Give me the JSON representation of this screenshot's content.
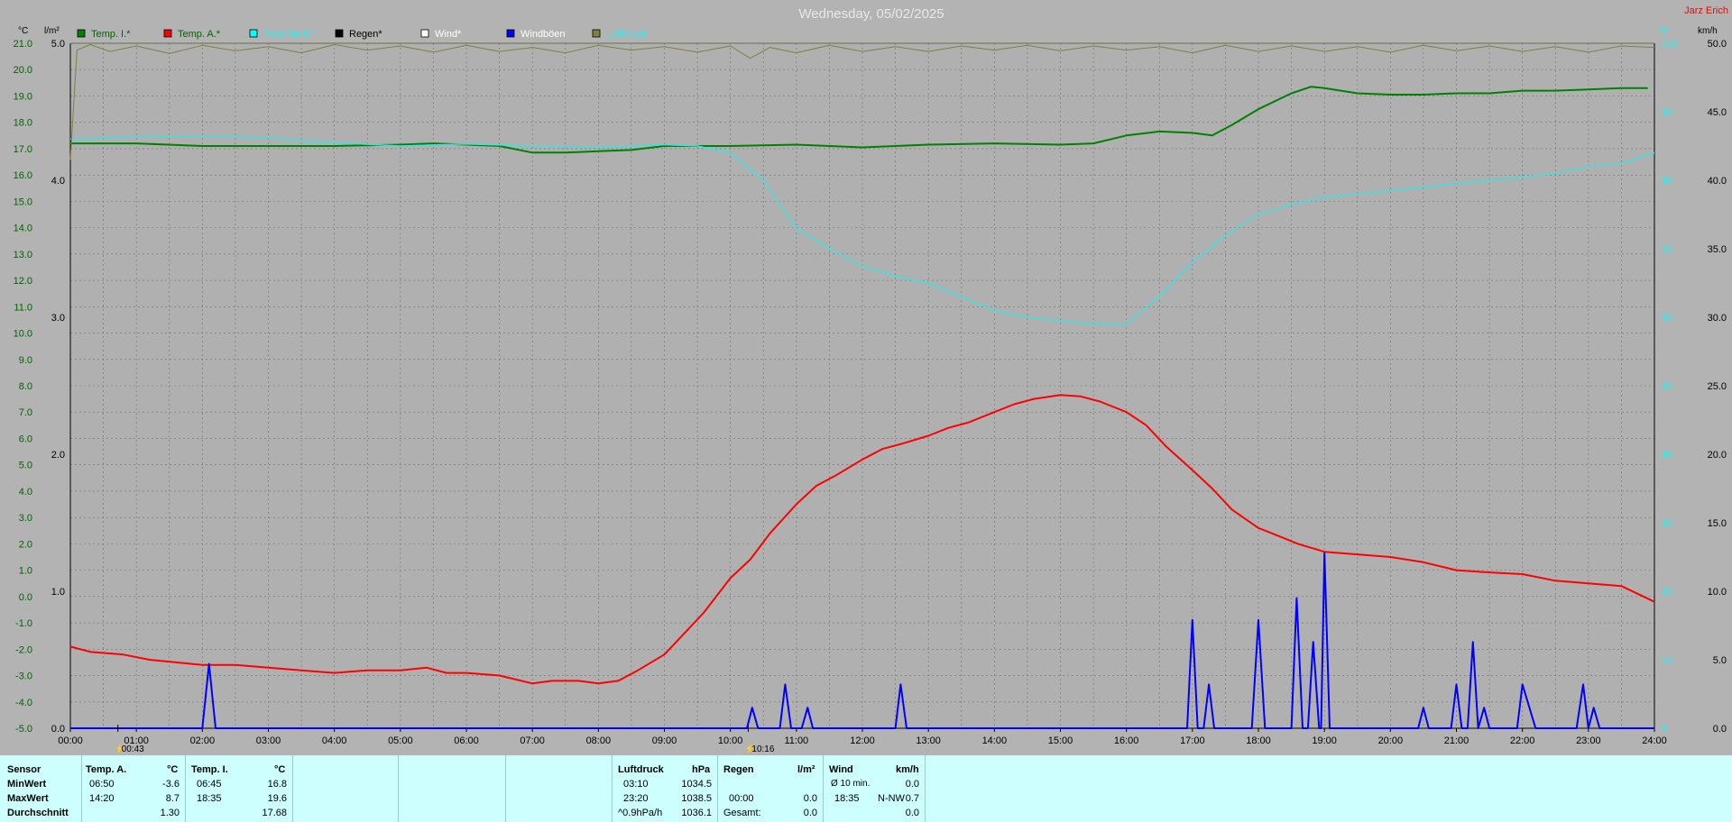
{
  "title": "Wednesday, 05/02/2025",
  "station": "Jarz Erich",
  "units": {
    "left1": "°C",
    "left2": "l/m²",
    "right1": "%",
    "right2": "km/h"
  },
  "legend": [
    {
      "label": "Temp. I.*",
      "color": "#008000",
      "text_color": "#006400"
    },
    {
      "label": "Temp. A.*",
      "color": "#ff0000",
      "text_color": "#006400"
    },
    {
      "label": "Feuchte A.*",
      "color": "#00ffff",
      "text_color": "#00ffff"
    },
    {
      "label": "Regen*",
      "color": "#000000",
      "text_color": "#000000"
    },
    {
      "label": "Wind*",
      "color": "#ffffff",
      "text_color": "#ffffff"
    },
    {
      "label": "Windböen",
      "color": "#0000ff",
      "text_color": "#ffffff"
    },
    {
      "label": "Luftdruck",
      "color": "#808040",
      "text_color": "#00ffff"
    }
  ],
  "markers": [
    {
      "label": "00:43"
    },
    {
      "label": "10:16"
    }
  ],
  "chart_data": {
    "type": "line",
    "x_unit": "hours",
    "x_ticks": [
      "00:00",
      "01:00",
      "02:00",
      "03:00",
      "04:00",
      "05:00",
      "06:00",
      "07:00",
      "08:00",
      "09:00",
      "10:00",
      "11:00",
      "12:00",
      "13:00",
      "14:00",
      "15:00",
      "16:00",
      "17:00",
      "18:00",
      "19:00",
      "20:00",
      "21:00",
      "22:00",
      "23:00",
      "24:00"
    ],
    "y_axes": {
      "temp": {
        "ticks": [
          "21.0",
          "20.0",
          "19.0",
          "18.0",
          "17.0",
          "16.0",
          "15.0",
          "14.0",
          "13.0",
          "12.0",
          "11.0",
          "10.0",
          "9.0",
          "8.0",
          "7.0",
          "6.0",
          "5.0",
          "4.0",
          "3.0",
          "2.0",
          "1.0",
          "0.0",
          "-1.0",
          "-2.0",
          "-3.0",
          "-4.0",
          "-5.0"
        ],
        "range": [
          -5,
          21
        ]
      },
      "rain": {
        "ticks": [
          "5.0",
          "4.0",
          "3.0",
          "2.0",
          "1.0",
          "0.0"
        ],
        "range": [
          0,
          5
        ]
      },
      "humidity": {
        "ticks": [
          "100",
          "90",
          "80",
          "70",
          "60",
          "50",
          "40",
          "30",
          "20",
          "10",
          "0"
        ],
        "range": [
          0,
          100
        ]
      },
      "wind": {
        "ticks": [
          "50.0",
          "45.0",
          "40.0",
          "35.0",
          "30.0",
          "25.0",
          "20.0",
          "15.0",
          "10.0",
          "5.0",
          "0.0"
        ],
        "range": [
          0,
          50
        ]
      }
    },
    "series": [
      {
        "name": "Temp. I.*",
        "axis": "temp",
        "color": "#008000",
        "width": 2,
        "points": [
          [
            0,
            17.2
          ],
          [
            1,
            17.2
          ],
          [
            2,
            17.1
          ],
          [
            3,
            17.1
          ],
          [
            4,
            17.1
          ],
          [
            5,
            17.15
          ],
          [
            5.5,
            17.2
          ],
          [
            6,
            17.15
          ],
          [
            6.5,
            17.1
          ],
          [
            7,
            16.85
          ],
          [
            7.5,
            16.85
          ],
          [
            8,
            16.9
          ],
          [
            8.5,
            16.95
          ],
          [
            9,
            17.1
          ],
          [
            10,
            17.1
          ],
          [
            11,
            17.15
          ],
          [
            12,
            17.05
          ],
          [
            13,
            17.15
          ],
          [
            14,
            17.2
          ],
          [
            15,
            17.15
          ],
          [
            15.5,
            17.2
          ],
          [
            16,
            17.5
          ],
          [
            16.5,
            17.65
          ],
          [
            17,
            17.6
          ],
          [
            17.3,
            17.5
          ],
          [
            17.6,
            17.9
          ],
          [
            18,
            18.5
          ],
          [
            18.5,
            19.1
          ],
          [
            18.8,
            19.35
          ],
          [
            19,
            19.3
          ],
          [
            19.5,
            19.1
          ],
          [
            20,
            19.05
          ],
          [
            20.5,
            19.05
          ],
          [
            21,
            19.1
          ],
          [
            21.5,
            19.1
          ],
          [
            22,
            19.2
          ],
          [
            22.5,
            19.2
          ],
          [
            23,
            19.25
          ],
          [
            23.5,
            19.3
          ],
          [
            23.9,
            19.3
          ]
        ]
      },
      {
        "name": "Temp. A.*",
        "axis": "temp",
        "color": "#ff0000",
        "width": 2,
        "points": [
          [
            0,
            -1.9
          ],
          [
            0.3,
            -2.1
          ],
          [
            0.8,
            -2.2
          ],
          [
            1.2,
            -2.4
          ],
          [
            1.6,
            -2.5
          ],
          [
            2,
            -2.6
          ],
          [
            2.5,
            -2.6
          ],
          [
            3,
            -2.7
          ],
          [
            3.5,
            -2.8
          ],
          [
            4,
            -2.9
          ],
          [
            4.5,
            -2.8
          ],
          [
            5,
            -2.8
          ],
          [
            5.4,
            -2.7
          ],
          [
            5.7,
            -2.9
          ],
          [
            6,
            -2.9
          ],
          [
            6.5,
            -3.0
          ],
          [
            7,
            -3.3
          ],
          [
            7.3,
            -3.2
          ],
          [
            7.7,
            -3.2
          ],
          [
            8,
            -3.3
          ],
          [
            8.3,
            -3.2
          ],
          [
            8.6,
            -2.8
          ],
          [
            9,
            -2.2
          ],
          [
            9.3,
            -1.4
          ],
          [
            9.6,
            -0.6
          ],
          [
            10,
            0.7
          ],
          [
            10.3,
            1.4
          ],
          [
            10.6,
            2.4
          ],
          [
            11,
            3.5
          ],
          [
            11.3,
            4.2
          ],
          [
            11.6,
            4.6
          ],
          [
            12,
            5.2
          ],
          [
            12.3,
            5.6
          ],
          [
            12.6,
            5.8
          ],
          [
            13,
            6.1
          ],
          [
            13.3,
            6.4
          ],
          [
            13.6,
            6.6
          ],
          [
            14,
            7.0
          ],
          [
            14.3,
            7.3
          ],
          [
            14.6,
            7.5
          ],
          [
            15,
            7.65
          ],
          [
            15.3,
            7.6
          ],
          [
            15.6,
            7.4
          ],
          [
            16,
            7.0
          ],
          [
            16.3,
            6.5
          ],
          [
            16.6,
            5.7
          ],
          [
            17,
            4.8
          ],
          [
            17.3,
            4.1
          ],
          [
            17.6,
            3.3
          ],
          [
            18,
            2.6
          ],
          [
            18.3,
            2.3
          ],
          [
            18.6,
            2.0
          ],
          [
            19,
            1.7
          ],
          [
            19.5,
            1.6
          ],
          [
            20,
            1.5
          ],
          [
            20.5,
            1.3
          ],
          [
            21,
            1.0
          ],
          [
            21.3,
            0.95
          ],
          [
            21.6,
            0.9
          ],
          [
            22,
            0.85
          ],
          [
            22.5,
            0.6
          ],
          [
            23,
            0.5
          ],
          [
            23.5,
            0.4
          ],
          [
            24,
            -0.2
          ]
        ]
      },
      {
        "name": "Feuchte A.*",
        "axis": "humidity",
        "color": "#40e0e0",
        "width": 1.5,
        "points": [
          [
            0,
            86
          ],
          [
            0.5,
            86.2
          ],
          [
            1,
            86.4
          ],
          [
            2,
            86.5
          ],
          [
            3,
            86.2
          ],
          [
            4,
            85.5
          ],
          [
            5,
            85
          ],
          [
            6,
            85.3
          ],
          [
            7,
            85
          ],
          [
            8,
            84.8
          ],
          [
            9,
            85.2
          ],
          [
            9.5,
            85
          ],
          [
            10,
            84
          ],
          [
            10.5,
            80
          ],
          [
            11,
            73
          ],
          [
            11.5,
            70
          ],
          [
            12,
            67.5
          ],
          [
            12.5,
            66
          ],
          [
            13,
            65
          ],
          [
            13.5,
            63
          ],
          [
            14,
            61
          ],
          [
            14.5,
            60
          ],
          [
            15,
            59.5
          ],
          [
            15.5,
            59
          ],
          [
            16,
            59
          ],
          [
            16.5,
            63
          ],
          [
            17,
            68
          ],
          [
            17.5,
            72
          ],
          [
            18,
            75
          ],
          [
            18.5,
            76.5
          ],
          [
            19,
            77.5
          ],
          [
            19.5,
            78
          ],
          [
            20,
            78.5
          ],
          [
            20.5,
            79
          ],
          [
            21,
            79.5
          ],
          [
            21.5,
            80
          ],
          [
            22,
            80.5
          ],
          [
            22.5,
            81
          ],
          [
            23,
            82
          ],
          [
            23.5,
            82.5
          ],
          [
            24,
            84
          ]
        ]
      },
      {
        "name": "Luftdruck",
        "axis": "humidity",
        "color": "#808040",
        "width": 1,
        "points": [
          [
            0,
            83
          ],
          [
            0.1,
            99
          ],
          [
            0.3,
            99.8
          ],
          [
            0.6,
            98.8
          ],
          [
            1,
            99.6
          ],
          [
            1.5,
            98.5
          ],
          [
            2,
            99.7
          ],
          [
            2.5,
            98.9
          ],
          [
            3,
            99.5
          ],
          [
            3.5,
            98.6
          ],
          [
            4,
            99.8
          ],
          [
            4.5,
            99
          ],
          [
            5,
            99.6
          ],
          [
            5.5,
            98.7
          ],
          [
            6,
            99.7
          ],
          [
            6.5,
            98.8
          ],
          [
            7,
            99.4
          ],
          [
            7.5,
            98.6
          ],
          [
            8,
            99.7
          ],
          [
            8.5,
            99
          ],
          [
            9,
            99.5
          ],
          [
            9.5,
            98.7
          ],
          [
            10,
            99.6
          ],
          [
            10.3,
            97.8
          ],
          [
            10.6,
            99.4
          ],
          [
            11,
            98.6
          ],
          [
            11.5,
            99.7
          ],
          [
            12,
            98.8
          ],
          [
            12.5,
            99.5
          ],
          [
            13,
            98.8
          ],
          [
            13.5,
            99.6
          ],
          [
            14,
            99
          ],
          [
            14.5,
            99.7
          ],
          [
            15,
            98.9
          ],
          [
            15.5,
            99.6
          ],
          [
            16,
            99
          ],
          [
            16.5,
            99.5
          ],
          [
            17,
            98.6
          ],
          [
            17.5,
            99.7
          ],
          [
            18,
            98.8
          ],
          [
            18.5,
            99.6
          ],
          [
            19,
            98.8
          ],
          [
            19.5,
            99.5
          ],
          [
            20,
            98.7
          ],
          [
            20.5,
            99.7
          ],
          [
            21,
            98.9
          ],
          [
            21.5,
            99.6
          ],
          [
            22,
            98.8
          ],
          [
            22.5,
            99.5
          ],
          [
            23,
            98.7
          ],
          [
            23.5,
            99.6
          ],
          [
            24,
            99.4
          ]
        ]
      },
      {
        "name": "Windböen",
        "axis": "wind",
        "color": "#0000ff",
        "width": 2,
        "points": [
          [
            0,
            0
          ],
          [
            2,
            0
          ],
          [
            2.1,
            4.7
          ],
          [
            2.2,
            0
          ],
          [
            10.25,
            0
          ],
          [
            10.33,
            1.5
          ],
          [
            10.42,
            0
          ],
          [
            10.75,
            0
          ],
          [
            10.83,
            3.2
          ],
          [
            10.92,
            0
          ],
          [
            11.08,
            0
          ],
          [
            11.17,
            1.5
          ],
          [
            11.25,
            0
          ],
          [
            12.5,
            0
          ],
          [
            12.58,
            3.2
          ],
          [
            12.67,
            0
          ],
          [
            16.92,
            0
          ],
          [
            17,
            7.9
          ],
          [
            17.08,
            0
          ],
          [
            17.17,
            0
          ],
          [
            17.25,
            3.2
          ],
          [
            17.33,
            0
          ],
          [
            17.9,
            0
          ],
          [
            18,
            7.9
          ],
          [
            18.1,
            0
          ],
          [
            18.5,
            0
          ],
          [
            18.58,
            9.5
          ],
          [
            18.67,
            0
          ],
          [
            18.75,
            0
          ],
          [
            18.83,
            6.3
          ],
          [
            18.92,
            0
          ],
          [
            18.95,
            0
          ],
          [
            19,
            12.8
          ],
          [
            19.08,
            0
          ],
          [
            20.42,
            0
          ],
          [
            20.5,
            1.5
          ],
          [
            20.58,
            0
          ],
          [
            20.92,
            0
          ],
          [
            21,
            3.2
          ],
          [
            21.08,
            0
          ],
          [
            21.17,
            0
          ],
          [
            21.25,
            6.3
          ],
          [
            21.33,
            0
          ],
          [
            21.33,
            0
          ],
          [
            21.42,
            1.5
          ],
          [
            21.5,
            0
          ],
          [
            21.92,
            0
          ],
          [
            22,
            3.2
          ],
          [
            22.2,
            0
          ],
          [
            22.82,
            0
          ],
          [
            22.92,
            3.2
          ],
          [
            23,
            0
          ],
          [
            23,
            0
          ],
          [
            23.08,
            1.5
          ],
          [
            23.17,
            0
          ],
          [
            24,
            0
          ]
        ]
      }
    ]
  },
  "stats": {
    "row_labels": [
      "Sensor",
      "MinWert",
      "MaxWert",
      "Durchschnitt"
    ],
    "temp_a": {
      "header": "Temp. A.",
      "unit": "°C",
      "min_time": "06:50",
      "min": "-3.6",
      "max_time": "14:20",
      "max": "8.7",
      "avg": "1.30"
    },
    "temp_i": {
      "header": "Temp. I.",
      "unit": "°C",
      "min_time": "06:45",
      "min": "16.8",
      "max_time": "18:35",
      "max": "19.6",
      "avg": "17.68"
    },
    "pressure": {
      "header": "Luftdruck",
      "unit": "hPa",
      "min_time": "03:10",
      "min": "1034.5",
      "max_time": "23:20",
      "max": "1038.5",
      "trend_label": "^0.9hPa/h",
      "avg": "1036.1"
    },
    "rain": {
      "header": "Regen",
      "unit": "l/m²",
      "max_time": "00:00",
      "max": "0.0",
      "total_label": "Gesamt:",
      "total": "0.0"
    },
    "wind": {
      "header": "Wind",
      "unit": "km/h",
      "avg_label": "Ø 10 min.",
      "avg": "0.0",
      "max_time": "18:35",
      "max_dir": "N-NW",
      "max": "0.7",
      "last": "0.0"
    }
  }
}
